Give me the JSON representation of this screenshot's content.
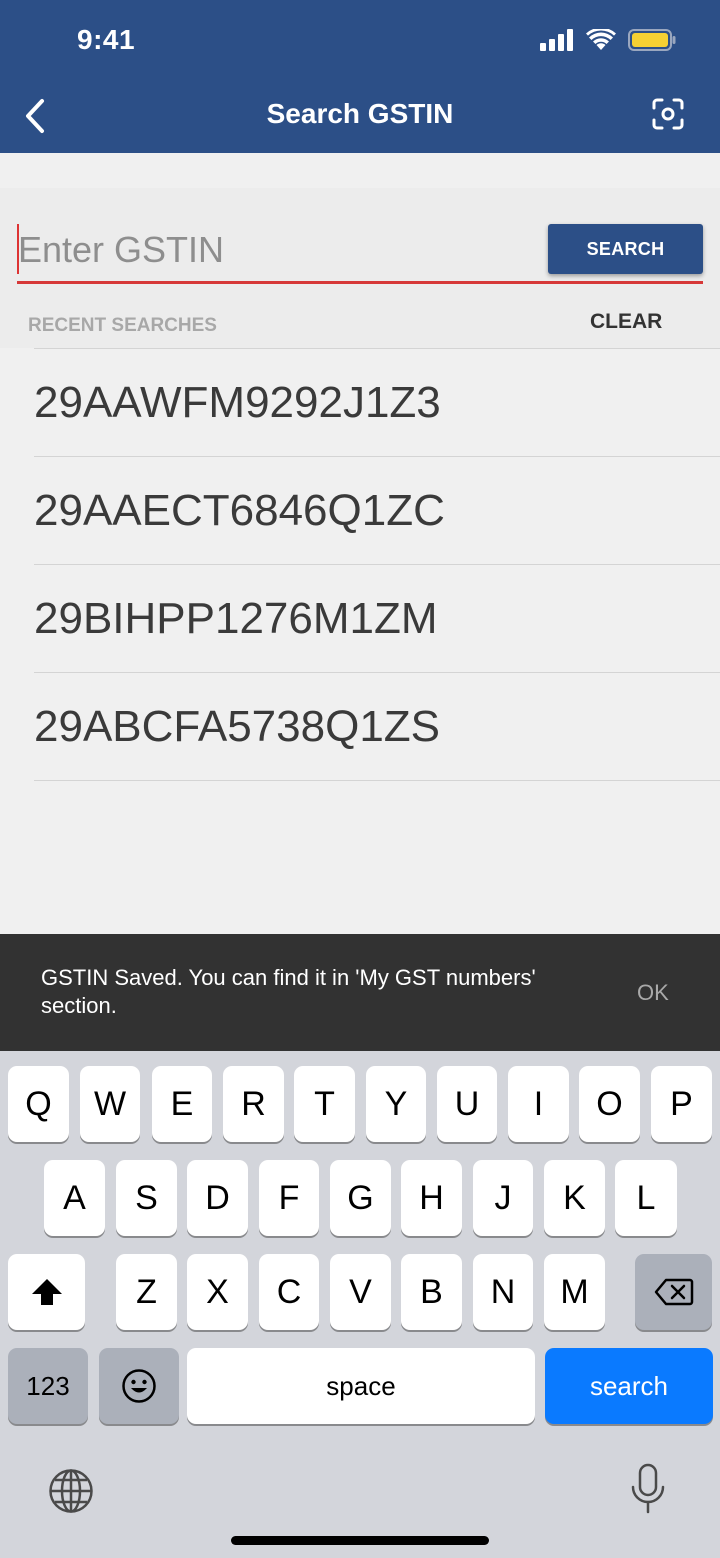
{
  "status_bar": {
    "time": "9:41"
  },
  "header": {
    "title": "Search GSTIN"
  },
  "search": {
    "placeholder": "Enter GSTIN",
    "value": "",
    "button_label": "SEARCH"
  },
  "recent": {
    "label": "RECENT SEARCHES",
    "clear_label": "CLEAR",
    "items": [
      "29AAWFM9292J1Z3",
      "29AAECT6846Q1ZC",
      "29BIHPP1276M1ZM",
      "29ABCFA5738Q1ZS"
    ]
  },
  "snackbar": {
    "message": "GSTIN Saved. You can find it in 'My GST numbers' section.",
    "action": "OK"
  },
  "keyboard": {
    "row1": [
      "Q",
      "W",
      "E",
      "R",
      "T",
      "Y",
      "U",
      "I",
      "O",
      "P"
    ],
    "row2": [
      "A",
      "S",
      "D",
      "F",
      "G",
      "H",
      "J",
      "K",
      "L"
    ],
    "row3": [
      "Z",
      "X",
      "C",
      "V",
      "B",
      "N",
      "M"
    ],
    "numbers_label": "123",
    "space_label": "space",
    "search_label": "search"
  },
  "colors": {
    "header": "#2c4f87",
    "accent_underline": "#d63838",
    "keyboard_action": "#0a7aff"
  }
}
